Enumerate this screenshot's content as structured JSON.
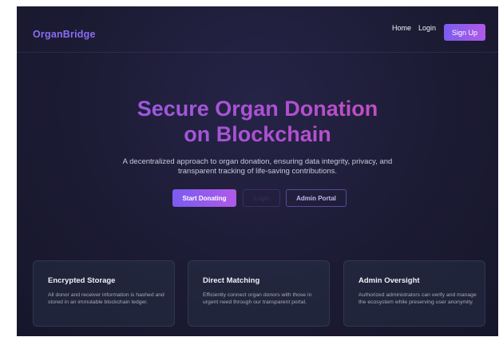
{
  "app": {
    "name": "OrganBridge"
  },
  "nav": {
    "links": [
      "Home",
      "Login"
    ],
    "signup_label": "Sign Up"
  },
  "hero": {
    "title_line1": "Secure Organ Donation",
    "title_line2": "on Blockchain",
    "description": "A decentralized approach to organ donation, ensuring data integrity, privacy, and transparent tracking of life-saving contributions.",
    "buttons": {
      "start": "Start Donating",
      "login": "Login",
      "admin": "Admin Portal"
    }
  },
  "features": [
    {
      "title": "Encrypted Storage",
      "text": "All donor and receiver information is hashed and stored in an immutable blockchain ledger."
    },
    {
      "title": "Direct Matching",
      "text": "Efficiently connect organ donors with those in urgent need through our transparent portal."
    },
    {
      "title": "Admin Oversight",
      "text": "Authorized administrators can verify and manage the ecosystem while preserving user anonymity."
    }
  ],
  "colors": {
    "accent_purple": "#7a5cf0",
    "accent_pink": "#d24fa8",
    "background": "#1c1b34"
  }
}
